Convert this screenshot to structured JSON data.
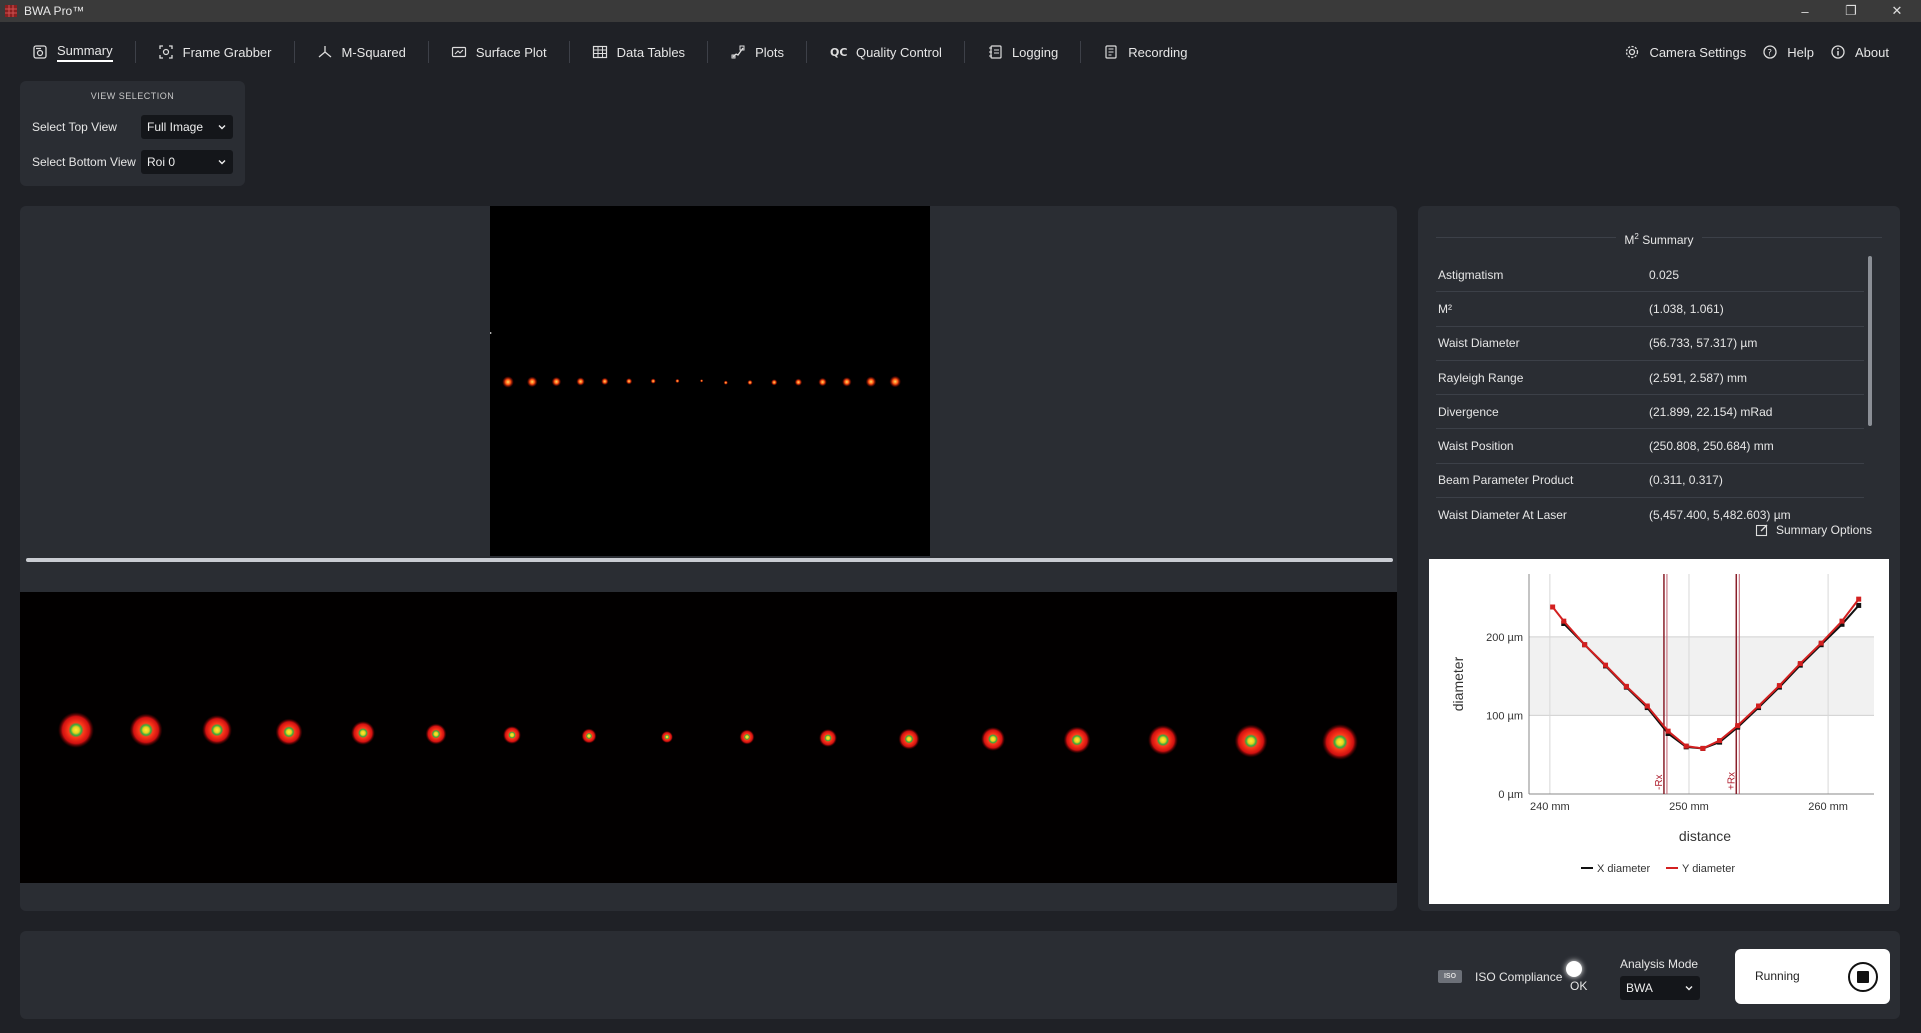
{
  "window": {
    "title": "BWA Pro™"
  },
  "nav": {
    "tabs": [
      {
        "label": "Summary",
        "icon": "summary-icon"
      },
      {
        "label": "Frame Grabber",
        "icon": "frame-grabber-icon"
      },
      {
        "label": "M-Squared",
        "icon": "m-squared-icon"
      },
      {
        "label": "Surface Plot",
        "icon": "surface-plot-icon"
      },
      {
        "label": "Data Tables",
        "icon": "table-icon"
      },
      {
        "label": "Plots",
        "icon": "plot-icon"
      },
      {
        "label": "Quality Control",
        "icon": "qc-icon"
      },
      {
        "label": "Logging",
        "icon": "logging-icon"
      },
      {
        "label": "Recording",
        "icon": "recording-icon"
      }
    ],
    "right": [
      {
        "label": "Camera Settings",
        "icon": "gear-icon"
      },
      {
        "label": "Help",
        "icon": "help-icon"
      },
      {
        "label": "About",
        "icon": "info-icon"
      }
    ]
  },
  "view_selection": {
    "header": "VIEW SELECTION",
    "top_label": "Select Top View",
    "top_value": "Full Image",
    "bottom_label": "Select Bottom View",
    "bottom_value": "Roi 0"
  },
  "summary": {
    "title_main": "M",
    "title_sup": "2",
    "title_rest": " Summary",
    "rows": [
      {
        "key": "Astigmatism",
        "value": "0.025"
      },
      {
        "key": "M²",
        "value": "(1.038, 1.061)"
      },
      {
        "key": "Waist Diameter",
        "value": "(56.733, 57.317) µm"
      },
      {
        "key": "Rayleigh Range",
        "value": "(2.591, 2.587) mm"
      },
      {
        "key": "Divergence",
        "value": "(21.899, 22.154) mRad"
      },
      {
        "key": "Waist Position",
        "value": "(250.808, 250.684) mm"
      },
      {
        "key": "Beam Parameter Product",
        "value": "(0.311, 0.317)"
      },
      {
        "key": "Waist Diameter At Laser",
        "value": "(5,457.400, 5,482.603) µm"
      }
    ],
    "options_label": "Summary Options"
  },
  "bottom": {
    "iso_badge": "ISO",
    "iso_label": "ISO Compliance",
    "iso_status": "OK",
    "analysis_label": "Analysis Mode",
    "analysis_value": "BWA",
    "run_label": "Running"
  },
  "chart_data": {
    "type": "line",
    "xlabel": "distance",
    "ylabel": "diameter",
    "xlim": [
      238.5,
      263.3
    ],
    "ylim": [
      0,
      280
    ],
    "x_ticks": [
      "240 mm",
      "250 mm",
      "260 mm"
    ],
    "x_tick_values": [
      240,
      250,
      260
    ],
    "y_ticks": [
      "0 µm",
      "100 µm",
      "200 µm"
    ],
    "y_tick_values": [
      0,
      100,
      200
    ],
    "shaded_band": [
      100,
      200
    ],
    "markers": [
      {
        "label": "-Rx",
        "x": 248.2
      },
      {
        "label": "+Rx",
        "x": 253.4
      }
    ],
    "series": [
      {
        "name": "X diameter",
        "color": "#111111",
        "x": [
          241.0,
          242.5,
          244.0,
          245.5,
          247.0,
          248.5,
          249.8,
          251.0,
          252.2,
          253.5,
          255.0,
          256.5,
          258.0,
          259.5,
          261.0,
          262.2
        ],
        "y": [
          217,
          190,
          163,
          136,
          110,
          77,
          60,
          58,
          66,
          85,
          110,
          136,
          164,
          190,
          216,
          240
        ]
      },
      {
        "name": "Y diameter",
        "color": "#d32020",
        "x": [
          240.2,
          241.0,
          242.5,
          244.0,
          245.5,
          247.0,
          248.5,
          249.8,
          251.0,
          252.2,
          253.5,
          255.0,
          256.5,
          258.0,
          259.5,
          261.0,
          262.2
        ],
        "y": [
          238,
          220,
          190,
          164,
          137,
          112,
          80,
          61,
          58,
          68,
          87,
          112,
          138,
          166,
          192,
          220,
          248
        ]
      }
    ]
  }
}
